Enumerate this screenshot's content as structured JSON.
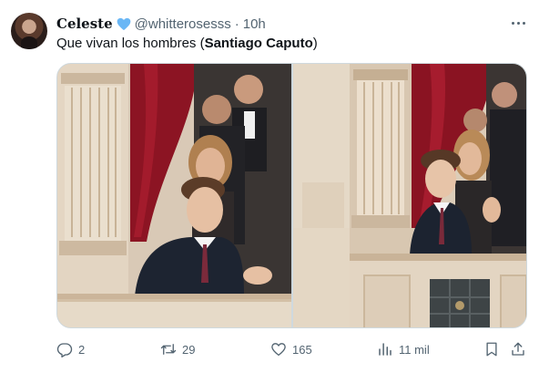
{
  "author": {
    "display_name": "Celeste",
    "verified_emoji": "blue-heart-icon",
    "handle": "@whitterosesss",
    "separator": "·",
    "time": "10h"
  },
  "tweet": {
    "text_prefix": "Que vivan los hombres (",
    "text_bold": "Santiago Caputo",
    "text_suffix": ")"
  },
  "media": {
    "count": 2,
    "items": [
      "photo-balcony-left",
      "photo-balcony-right"
    ]
  },
  "actions": {
    "replies": "2",
    "retweets": "29",
    "likes": "165",
    "views": "11 mil"
  },
  "colors": {
    "muted": "#536471",
    "text": "#0f1419",
    "border": "#cfd9de",
    "heart": "#6ab7f5"
  }
}
